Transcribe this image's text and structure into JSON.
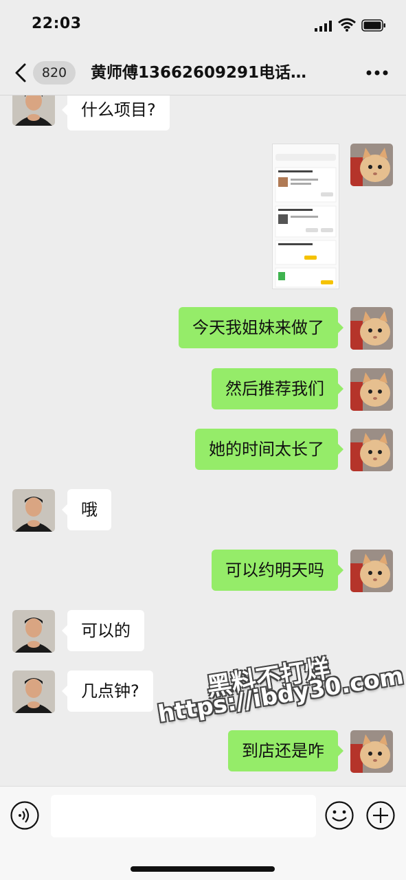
{
  "status_bar": {
    "time": "22:03",
    "icons": [
      "signal-icon",
      "wifi-icon",
      "battery-icon"
    ]
  },
  "nav": {
    "unread_count": "820",
    "title": "黄师傅13662609291电话…",
    "icons": [
      "back-chevron-icon",
      "more-dots-icon"
    ]
  },
  "messages": [
    {
      "side": "in",
      "text": "什么项目?"
    },
    {
      "side": "out",
      "type": "image",
      "text": ""
    },
    {
      "side": "out",
      "text": "今天我姐妹来做了"
    },
    {
      "side": "out",
      "text": "然后推荐我们"
    },
    {
      "side": "out",
      "text": "她的时间太长了"
    },
    {
      "side": "in",
      "text": "哦"
    },
    {
      "side": "out",
      "text": "可以约明天吗"
    },
    {
      "side": "in",
      "text": "可以的"
    },
    {
      "side": "in",
      "text": "几点钟?"
    },
    {
      "side": "out",
      "text": "到店还是咋"
    }
  ],
  "watermark": {
    "line1": "黑料不打烊",
    "line2": "https://ibdy30.com"
  },
  "input_bar": {
    "value": "",
    "icons": [
      "voice-icon",
      "emoji-icon",
      "plus-icon"
    ]
  },
  "colors": {
    "background": "#ededed",
    "outgoing_bubble": "#95ec69",
    "incoming_bubble": "#ffffff",
    "input_bar": "#f7f7f7"
  }
}
